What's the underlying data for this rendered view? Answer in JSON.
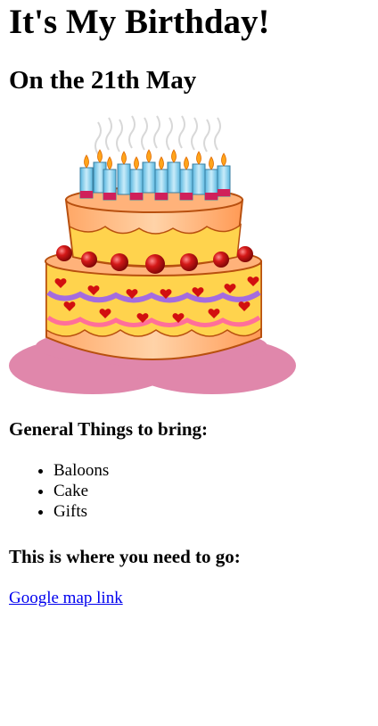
{
  "page": {
    "title": "It's My Birthday!",
    "subtitle": "On the 21th May"
  },
  "cake_image": {
    "icon": "birthday-cake-icon",
    "colors": {
      "plate": "#e087ab",
      "cake_body": "#ffb27a",
      "cream": "#ffd34d",
      "outline": "#b8500f",
      "cherry": "#c81010",
      "heart": "#d20f0f",
      "candle": "#8fd3ef",
      "flame": "#ffa41a",
      "purple_wave": "#a46ce0",
      "pink_wave": "#ff6f9a"
    }
  },
  "bring": {
    "heading": "General Things to bring:",
    "items": [
      "Baloons",
      "Cake",
      "Gifts"
    ]
  },
  "location": {
    "heading": "This is where you need to go:",
    "link_text": "Google map link"
  }
}
